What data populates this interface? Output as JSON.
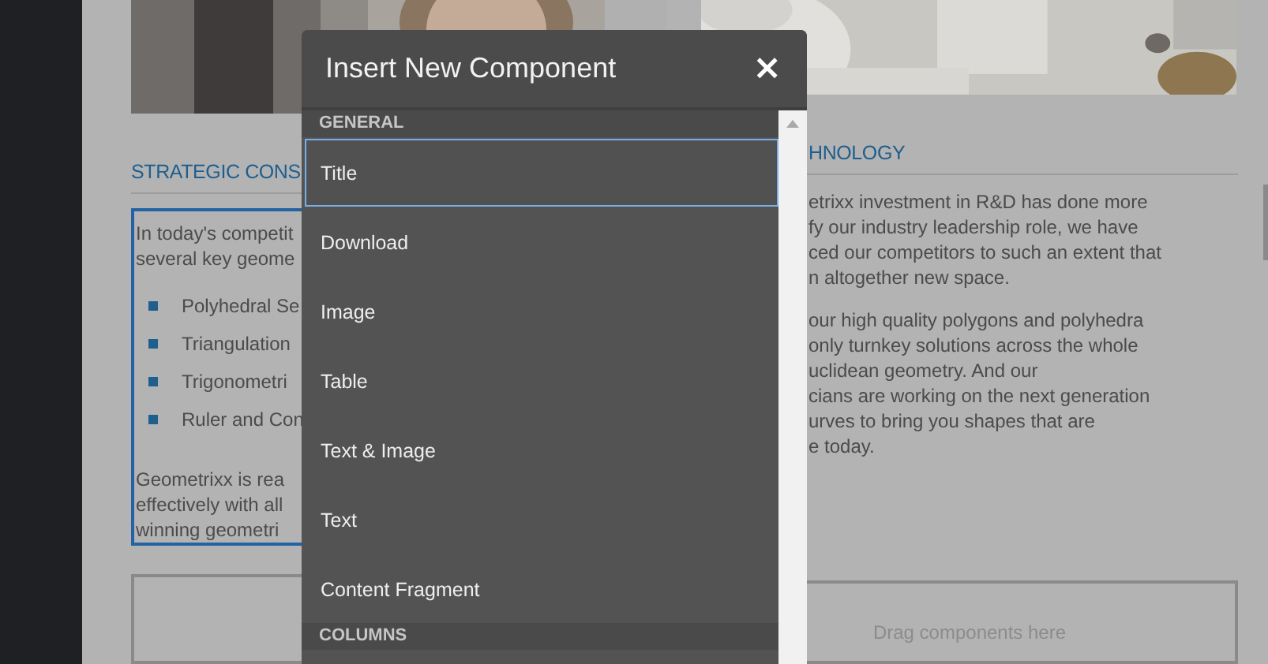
{
  "page": {
    "left_column": {
      "heading": "STRATEGIC CONS",
      "intro_lines": [
        "In today's competit",
        "several key geome"
      ],
      "bullets": [
        "Polyhedral Se",
        "Triangulation",
        "Trigonometri",
        "Ruler and Con"
      ],
      "outro_lines": [
        "Geometrixx is rea",
        "effectively with all",
        "winning geometri"
      ]
    },
    "right_column": {
      "heading": "HNOLOGY",
      "para1_lines": [
        "etrixx investment in R&D has done more",
        "fy our industry leadership role, we have",
        "ced our competitors to such an extent that",
        "n altogether new space."
      ],
      "para2_lines": [
        "our high quality polygons and polyhedra",
        "only turnkey solutions across the whole",
        "uclidean geometry. And our",
        "cians are working on the next generation",
        "urves to bring you shapes that are",
        "e today."
      ],
      "drop_zone": "Drag components here"
    }
  },
  "dialog": {
    "title": "Insert New Component",
    "close": "×",
    "groups": [
      {
        "name": "GENERAL",
        "items": [
          {
            "label": "Title",
            "selected": true
          },
          {
            "label": "Download",
            "selected": false
          },
          {
            "label": "Image",
            "selected": false
          },
          {
            "label": "Table",
            "selected": false
          },
          {
            "label": "Text & Image",
            "selected": false
          },
          {
            "label": "Text",
            "selected": false
          },
          {
            "label": "Content Fragment",
            "selected": false
          }
        ]
      },
      {
        "name": "COLUMNS"
      }
    ]
  }
}
